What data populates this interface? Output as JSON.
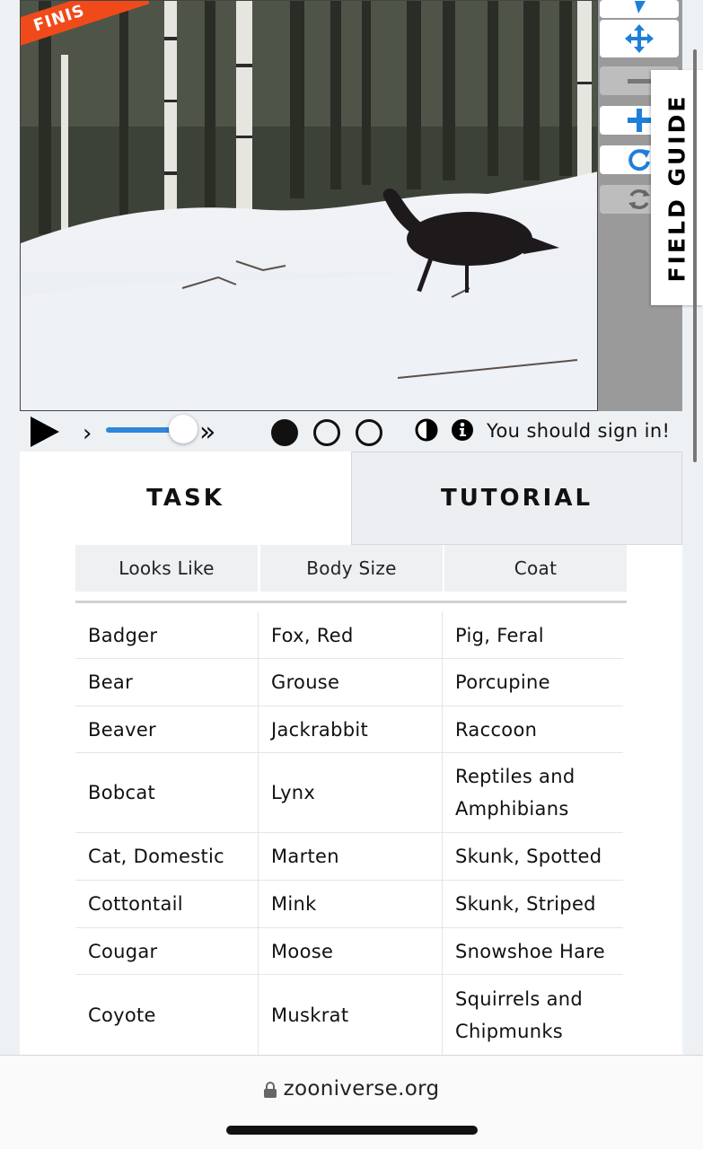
{
  "subject": {
    "banner": "FINIS"
  },
  "toolbar": {
    "tools": [
      "pointer-icon",
      "move-icon",
      "zoom-out-icon",
      "zoom-in-icon",
      "rotate-icon",
      "reset-icon"
    ]
  },
  "field_guide": {
    "label": "FIELD GUIDE"
  },
  "controls": {
    "step_back": "›",
    "fast_forward": "»",
    "frames": 3,
    "active_frame": 1,
    "signin_text": "You should sign in!"
  },
  "tabs": [
    {
      "label": "TASK",
      "active": true
    },
    {
      "label": "TUTORIAL",
      "active": false
    }
  ],
  "filters": [
    "Looks Like",
    "Body Size",
    "Coat"
  ],
  "choices": [
    [
      "Badger",
      "Fox, Red",
      "Pig, Feral"
    ],
    [
      "Bear",
      "Grouse",
      "Porcupine"
    ],
    [
      "Beaver",
      "Jackrabbit",
      "Raccoon"
    ],
    [
      "Bobcat",
      "Lynx",
      "Reptiles and Amphibians"
    ],
    [
      "Cat, Domestic",
      "Marten",
      "Skunk, Spotted"
    ],
    [
      "Cottontail",
      "Mink",
      "Skunk, Striped"
    ],
    [
      "Cougar",
      "Moose",
      "Snowshoe Hare"
    ],
    [
      "Coyote",
      "Muskrat",
      "Squirrels and Chipmunks"
    ]
  ],
  "browser": {
    "url": "zooniverse.org"
  },
  "colors": {
    "accent": "#2f86d8",
    "banner": "#f04a1a",
    "toolbar": "#9a9a9a"
  }
}
